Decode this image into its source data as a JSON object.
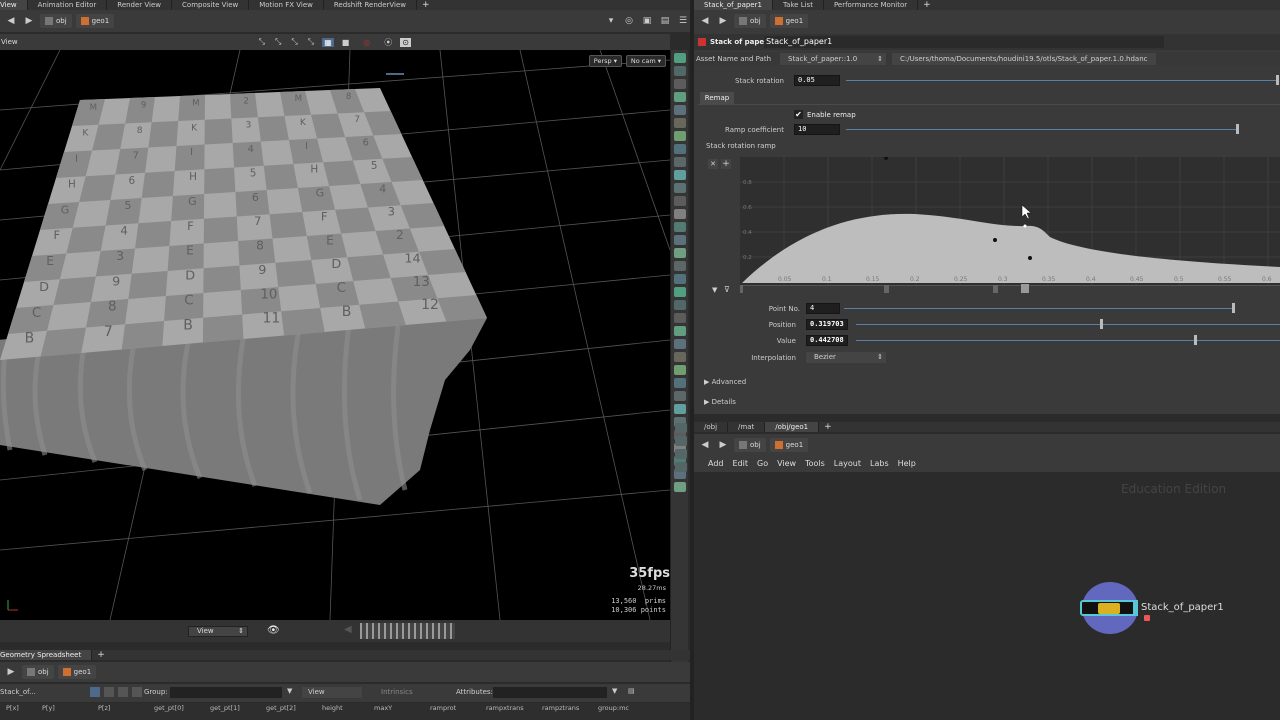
{
  "left_tabs": [
    "View",
    "Animation Editor",
    "Render View",
    "Composite View",
    "Motion FX View",
    "Redshift RenderView"
  ],
  "right_tabs": [
    "Stack_of_paper1",
    "Take List",
    "Performance Monitor"
  ],
  "path": {
    "obj": "obj",
    "geo": "geo1"
  },
  "viewport": {
    "label": "View",
    "persp_button": "Persp ▾",
    "cam_button": "No cam ▾",
    "fps": "35fps",
    "ms": "28.27ms",
    "prims_count": "13,560",
    "prims_label": "prims",
    "points_count": "10,306",
    "points_label": "points",
    "bottom_view": "View"
  },
  "grid_letters": [
    [
      "B",
      "7",
      "B",
      "11",
      "B",
      "12"
    ],
    [
      "C",
      "8",
      "C",
      "10",
      "C",
      "13"
    ],
    [
      "D",
      "9",
      "D",
      "9",
      "D",
      "14"
    ],
    [
      "E",
      "3",
      "E",
      "8",
      "E",
      "2"
    ],
    [
      "F",
      "4",
      "F",
      "7",
      "F",
      "3"
    ],
    [
      "G",
      "5",
      "G",
      "6",
      "G",
      "4"
    ],
    [
      "H",
      "6",
      "H",
      "5",
      "H",
      "5"
    ],
    [
      "I",
      "7",
      "I",
      "4",
      "I",
      "6"
    ],
    [
      "K",
      "8",
      "K",
      "3",
      "K",
      "7"
    ],
    [
      "M",
      "9",
      "M",
      "2",
      "M",
      "8"
    ]
  ],
  "params": {
    "node_type": "Stack of paper",
    "node_name": "Stack_of_paper1",
    "asset_label": "Asset Name and Path",
    "asset_name": "Stack_of_paper::1.0",
    "asset_path": "C:/Users/thoma/Documents/houdini19.5/otls/Stack_of_paper.1.0.hdanc",
    "stack_rotation_label": "Stack rotation",
    "stack_rotation": "0.05",
    "tab_remap": "Remap",
    "enable_remap": "Enable remap",
    "ramp_coef_label": "Ramp coefficient",
    "ramp_coef": "10",
    "ramp_label": "Stack rotation ramp",
    "ramp_x_ticks": [
      "0.05",
      "0.1",
      "0.15",
      "0.2",
      "0.25",
      "0.3",
      "0.35",
      "0.4",
      "0.45",
      "0.5",
      "0.55",
      "0.6"
    ],
    "ramp_y_ticks": [
      "0.8",
      "0.6",
      "0.4",
      "0.2"
    ],
    "point_no_label": "Point No.",
    "point_no": "4",
    "position_label": "Position",
    "position": "0.319703",
    "value_label": "Value",
    "value": "0.442708",
    "interp_label": "Interpolation",
    "interp": "Bezier",
    "advanced": "Advanced",
    "details": "Details"
  },
  "network": {
    "tabs": [
      "/obj",
      "/mat",
      "/obj/geo1"
    ],
    "menu": [
      "Add",
      "Edit",
      "Go",
      "View",
      "Tools",
      "Layout",
      "Labs",
      "Help"
    ],
    "watermark": "Education Edition",
    "node_label": "Stack_of_paper1"
  },
  "spreadsheet": {
    "tab": "Geometry Spreadsheet",
    "node": "Stack_of...",
    "group_label": "Group:",
    "view": "View",
    "intrinsics": "Intrinsics",
    "attributes_label": "Attributes:",
    "columns": [
      "P[x]",
      "P[y]",
      "P[z]",
      "get_pt[0]",
      "get_pt[1]",
      "get_pt[2]",
      "height",
      "maxY",
      "ramprot",
      "rampxtrans",
      "rampztrans",
      "group:mc"
    ]
  },
  "colors": {
    "accent": "#5a7fa8",
    "ramp_fill": "#bdbdbd",
    "node_ring": "#6a6fd0",
    "node_badge": "#f0c020"
  }
}
